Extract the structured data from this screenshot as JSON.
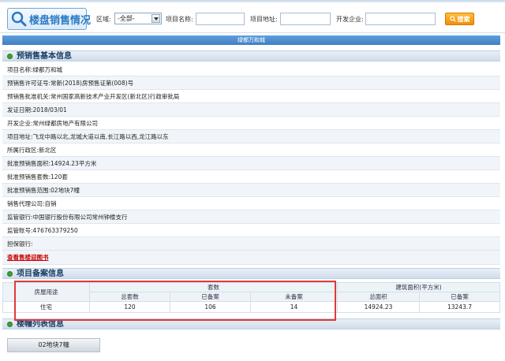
{
  "header": {
    "logo_text": "楼盘销售情况",
    "filters": {
      "district_label": "区域:",
      "district_value": "-全部-",
      "project_name_label": "项目名称:",
      "project_address_label": "项目地址:",
      "developer_label": "开发企业:",
      "search_label": "搜索"
    }
  },
  "title_bar": "绿都万和城",
  "presale": {
    "title": "预销售基本信息",
    "rows": [
      {
        "label": "项目名称:",
        "value": "绿都万和城"
      },
      {
        "label": "预销售许可证号:",
        "value": "常新(2018)房预售证第(008)号"
      },
      {
        "label": "预销售批准机关:",
        "value": "常州国家高新技术产业开发区(新北区)行政审批局"
      },
      {
        "label": "发证日期:",
        "value": "2018/03/01"
      },
      {
        "label": "开发企业:",
        "value": "常州绿都房地产有限公司"
      },
      {
        "label": "项目地址:",
        "value": "飞龙中路以北,龙城大道以南,长江路以西,龙江路以东"
      },
      {
        "label": "所属行政区:",
        "value": "新北区"
      },
      {
        "label": "批准预销售面积:",
        "value": "14924.23平方米"
      },
      {
        "label": "批准预销售套数:",
        "value": "120套"
      },
      {
        "label": "批准预销售范围:",
        "value": "02地块7幢"
      },
      {
        "label": "销售代理公司:",
        "value": "自销"
      },
      {
        "label": "监管银行:",
        "value": "中国银行股份有限公司常州钟楼支行"
      },
      {
        "label": "监管账号:",
        "value": "476763379250"
      },
      {
        "label": "担保银行:",
        "value": ""
      }
    ],
    "map_link": "查看售楼迎图书"
  },
  "record": {
    "title": "项目备案信息",
    "headers": {
      "usage": "房屋用途",
      "units_group": "套数",
      "area_group": "建筑面积(平方米)",
      "total_units": "总套数",
      "filed_units": "已备案",
      "unfiled_units": "未备案",
      "total_area": "总面积",
      "filed_area": "已备案"
    },
    "rows": [
      {
        "usage": "住宅",
        "total_units": "120",
        "filed_units": "106",
        "unfiled_units": "14",
        "total_area": "14924.23",
        "filed_area": "13243.7"
      }
    ]
  },
  "buildings": {
    "title": "楼幢列表信息",
    "items": [
      "02地块7幢"
    ]
  }
}
